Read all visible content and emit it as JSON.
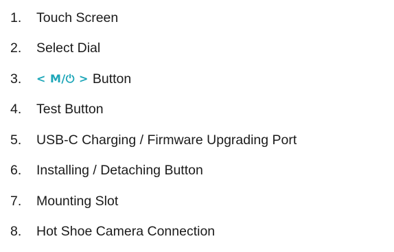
{
  "accent_color": "#1ca6b8",
  "parts": [
    {
      "number": "1.",
      "label": "Touch Screen"
    },
    {
      "number": "2.",
      "label": "Select Dial"
    },
    {
      "number": "3.",
      "glyph": "< M/⏻ >",
      "label": "Button"
    },
    {
      "number": "4.",
      "label": "Test Button"
    },
    {
      "number": "5.",
      "label": "USB-C Charging / Firmware Upgrading Port"
    },
    {
      "number": "6.",
      "label": "Installing / Detaching Button"
    },
    {
      "number": "7.",
      "label": "Mounting Slot"
    },
    {
      "number": "8.",
      "label": "Hot Shoe Camera Connection"
    }
  ]
}
